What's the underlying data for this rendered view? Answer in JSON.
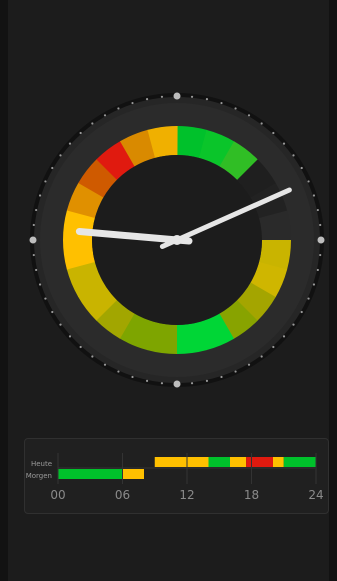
{
  "clock": {
    "time": {
      "hour": 9,
      "minute": 10
    },
    "colors": {
      "face_outer": "#2a2a2a",
      "face_inner": "#1d1d1d",
      "hands": "#e6e6e6",
      "ring_inner": "#151515"
    },
    "ring_segments": [
      {
        "color": "#00c12b"
      },
      {
        "color": "#0ac52a"
      },
      {
        "color": "#30be25"
      },
      {
        "color": "#1f1f1f"
      },
      {
        "color": "#222222"
      },
      {
        "color": "#2a2a2a"
      },
      {
        "color": "#c9b400"
      },
      {
        "color": "#cfb600"
      },
      {
        "color": "#a4a500"
      },
      {
        "color": "#88a300"
      },
      {
        "color": "#00d636"
      },
      {
        "color": "#00d636"
      },
      {
        "color": "#7ea500"
      },
      {
        "color": "#7ea500"
      },
      {
        "color": "#a2a600"
      },
      {
        "color": "#c9b400"
      },
      {
        "color": "#c9b400"
      },
      {
        "color": "#ffc000"
      },
      {
        "color": "#ffc000"
      },
      {
        "color": "#e09000"
      },
      {
        "color": "#cf5a00"
      },
      {
        "color": "#e01a0f"
      },
      {
        "color": "#d98a00"
      },
      {
        "color": "#f0b000"
      }
    ]
  },
  "forecast": {
    "labels": {
      "today": "Heute",
      "tomorrow": "Morgen"
    },
    "axis_ticks": [
      "00",
      "06",
      "12",
      "18",
      "24"
    ],
    "today": [
      {
        "start": 9,
        "end": 12,
        "color": "#ffc000"
      },
      {
        "start": 12,
        "end": 14,
        "color": "#ffc000"
      },
      {
        "start": 14,
        "end": 16,
        "color": "#00c12b"
      },
      {
        "start": 16,
        "end": 17.5,
        "color": "#ffc000"
      },
      {
        "start": 17.5,
        "end": 20,
        "color": "#e01a0f"
      },
      {
        "start": 20,
        "end": 21,
        "color": "#ffc000"
      },
      {
        "start": 21,
        "end": 24,
        "color": "#00c12b"
      }
    ],
    "tomorrow": [
      {
        "start": 0,
        "end": 6,
        "color": "#00c12b"
      },
      {
        "start": 6,
        "end": 8,
        "color": "#ffc000"
      }
    ]
  }
}
